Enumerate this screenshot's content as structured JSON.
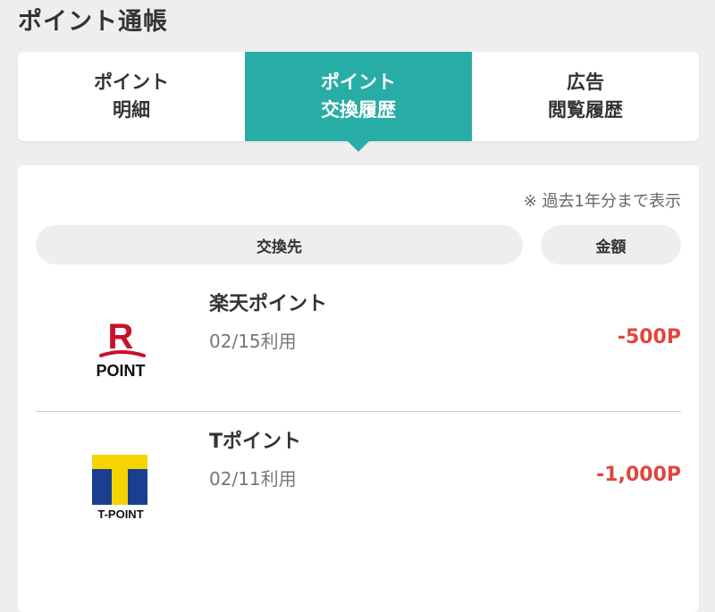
{
  "page": {
    "title": "ポイント通帳"
  },
  "tabs": [
    {
      "label": "ポイント\n明細",
      "active": false
    },
    {
      "label": "ポイント\n交換履歴",
      "active": true
    },
    {
      "label": "広告\n閲覧履歴",
      "active": false
    }
  ],
  "panel": {
    "note": "※ 過去1年分まで表示",
    "headers": {
      "destination": "交換先",
      "amount": "金額"
    }
  },
  "history": [
    {
      "name": "楽天ポイント",
      "date": "02/15利用",
      "amount": "-500P",
      "logo": "rakuten-point-logo",
      "logo_text": "POINT"
    },
    {
      "name": "Tポイント",
      "date": "02/11利用",
      "amount": "-1,000P",
      "logo": "t-point-logo",
      "logo_text": "T-POINT"
    }
  ],
  "colors": {
    "accent": "#28ada6",
    "negative": "#e0453f",
    "background": "#eeeeee"
  }
}
